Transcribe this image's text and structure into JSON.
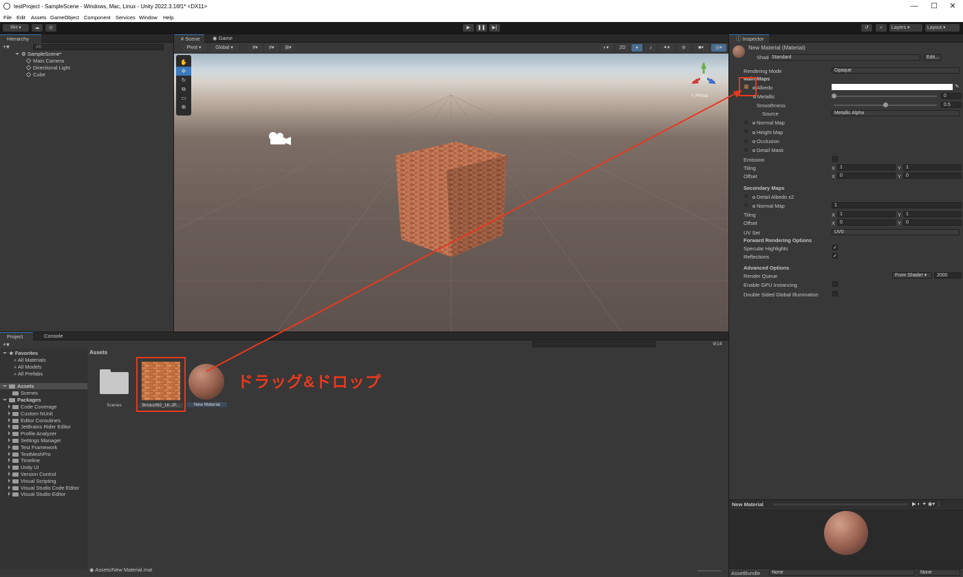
{
  "window": {
    "title": "testProject - SampleScene - Windows, Mac, Linux - Unity 2022.3.16f1* <DX11>",
    "minimize": "—",
    "maximize": "☐",
    "close": "✕"
  },
  "menu": [
    "File",
    "Edit",
    "Assets",
    "GameObject",
    "Component",
    "Services",
    "Window",
    "Help"
  ],
  "toolbar": {
    "account": "RH ▾",
    "layers": "Layers",
    "layout": "Layout"
  },
  "hierarchy": {
    "tab": "Hierarchy",
    "search_placeholder": "All",
    "scene": "SampleScene*",
    "items": [
      "Main Camera",
      "Directional Light",
      "Cube"
    ]
  },
  "scene_view": {
    "tabs": [
      "Scene",
      "Game"
    ],
    "pivot": "Pivot",
    "global": "Global",
    "mode_2d": "2D",
    "persp": "< Persp"
  },
  "project": {
    "tabs": [
      "Project",
      "Console"
    ],
    "badge": "14",
    "favorites": {
      "label": "Favorites",
      "items": [
        "All Materials",
        "All Models",
        "All Prefabs"
      ]
    },
    "assets_label": "Assets",
    "assets_children": [
      "Scenes"
    ],
    "packages_label": "Packages",
    "packages": [
      "Code Coverage",
      "Custom NUnit",
      "Editor Coroutines",
      "JetBrains Rider Editor",
      "Profile Analyzer",
      "Settings Manager",
      "Test Framework",
      "TextMeshPro",
      "Timeline",
      "Unity UI",
      "Version Control",
      "Visual Scripting",
      "Visual Studio Code Editor",
      "Visual Studio Editor"
    ],
    "breadcrumb": "Assets",
    "grid_items": [
      "Scenes",
      "Bricks092_1K-JP...",
      "New Material"
    ],
    "footer_path": "Assets/New Material.mat"
  },
  "annotation": {
    "text": "ドラッグ&ドロップ",
    "color": "#e8391e"
  },
  "inspector": {
    "tab": "Inspector",
    "title": "New Material (Material)",
    "shader_label": "Shader",
    "shader_value": "Standard",
    "edit": "Edit...",
    "rendering_mode": {
      "label": "Rendering Mode",
      "value": "Opaque"
    },
    "main_maps": "Main Maps",
    "albedo": "Albedo",
    "metallic": {
      "label": "Metallic",
      "value": "0",
      "fraction": 0
    },
    "smoothness": {
      "label": "Smoothness",
      "value": "0.5",
      "fraction": 0.5
    },
    "source": {
      "label": "Source",
      "value": "Metallic Alpha"
    },
    "maps": [
      "Normal Map",
      "Height Map",
      "Occlusion",
      "Detail Mask"
    ],
    "emission": "Emission",
    "tiling": {
      "label": "Tiling",
      "x": "1",
      "y": "1"
    },
    "offset": {
      "label": "Offset",
      "x": "0",
      "y": "0"
    },
    "secondary_maps": "Secondary Maps",
    "detail_albedo": "Detail Albedo x2",
    "sec_normal": {
      "label": "Normal Map",
      "value": "1"
    },
    "sec_tiling": {
      "label": "Tiling",
      "x": "1",
      "y": "1"
    },
    "sec_offset": {
      "label": "Offset",
      "x": "0",
      "y": "0"
    },
    "uv_set": {
      "label": "UV Set",
      "value": "UV0"
    },
    "forward_options": "Forward Rendering Options",
    "specular": "Specular Highlights",
    "reflections": "Reflections",
    "advanced": "Advanced Options",
    "render_queue": {
      "label": "Render Queue",
      "mode": "From Shader",
      "value": "2000"
    },
    "gpu_instancing": "Enable GPU Instancing",
    "double_sided": "Double Sided Global Illumination",
    "preview_title": "New Material",
    "assetbundle": {
      "label": "AssetBundle",
      "value": "None",
      "variant": "None"
    }
  },
  "colors": {
    "accent": "#3a79bb",
    "annotation": "#e8391e",
    "panel": "#383838"
  }
}
